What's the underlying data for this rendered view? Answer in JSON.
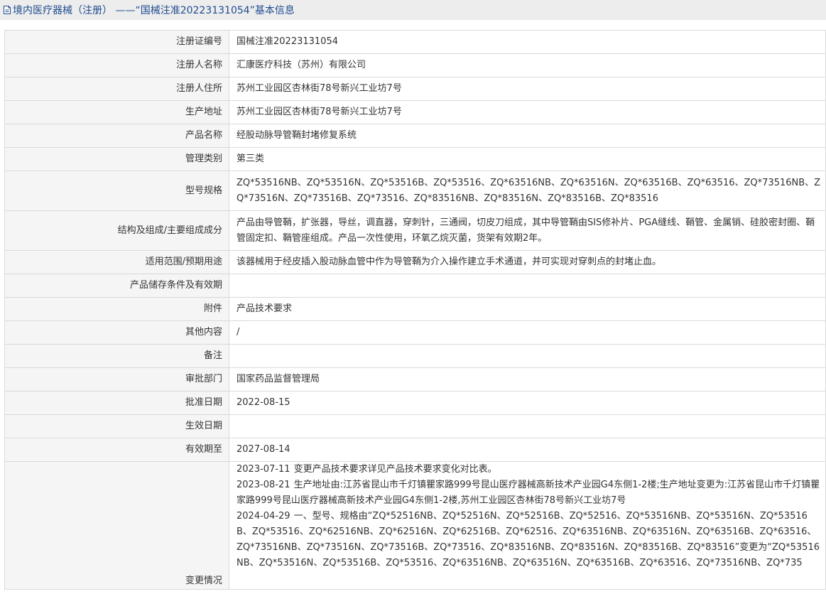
{
  "header": {
    "title": "境内医疗器械（注册） ——“国械注准20223131054”基本信息",
    "icon": "document-icon"
  },
  "rows": [
    {
      "label": "注册证编号",
      "value": "国械注准20223131054"
    },
    {
      "label": "注册人名称",
      "value": "汇康医疗科技（苏州）有限公司"
    },
    {
      "label": "注册人住所",
      "value": "苏州工业园区杏林街78号新兴工业坊7号"
    },
    {
      "label": "生产地址",
      "value": "苏州工业园区杏林街78号新兴工业坊7号"
    },
    {
      "label": "产品名称",
      "value": "经股动脉导管鞘封堵修复系统"
    },
    {
      "label": "管理类别",
      "value": "第三类"
    },
    {
      "label": "型号规格",
      "value": "ZQ*53516NB、ZQ*53516N、ZQ*53516B、ZQ*53516、ZQ*63516NB、ZQ*63516N、ZQ*63516B、ZQ*63516、ZQ*73516NB、ZQ*73516N、ZQ*73516B、ZQ*73516、ZQ*83516NB、ZQ*83516N、ZQ*83516B、ZQ*83516"
    },
    {
      "label": "结构及组成/主要组成成分",
      "value": "产品由导管鞘，扩张器，导丝，调直器，穿刺针，三通阀，切皮刀组成，其中导管鞘由SIS修补片、PGA缝线、鞘管、金属销、硅胶密封圈、鞘管固定扣、鞘管座组成。产品一次性使用，环氧乙烷灭菌，货架有效期2年。"
    },
    {
      "label": "适用范围/预期用途",
      "value": "该器械用于经皮插入股动脉血管中作为导管鞘为介入操作建立手术通道，并可实现对穿刺点的封堵止血。"
    },
    {
      "label": "产品储存条件及有效期",
      "value": ""
    },
    {
      "label": "附件",
      "value": "产品技术要求"
    },
    {
      "label": "其他内容",
      "value": "/"
    },
    {
      "label": "备注",
      "value": ""
    },
    {
      "label": "审批部门",
      "value": "国家药品监督管理局"
    },
    {
      "label": "批准日期",
      "value": "2022-08-15"
    },
    {
      "label": "生效日期",
      "value": ""
    },
    {
      "label": "有效期至",
      "value": "2027-08-14"
    }
  ],
  "changes": {
    "label": "变更情况",
    "entries": [
      {
        "date": "2023-07-11",
        "text": "变更产品技术要求详见产品技术要求变化对比表。"
      },
      {
        "date": "2023-08-21",
        "text": "生产地址由:江苏省昆山市千灯镇瞿家路999号昆山医疗器械高新技术产业园G4东侧1-2楼;生产地址变更为:江苏省昆山市千灯镇瞿家路999号昆山医疗器械高新技术产业园G4东侧1-2楼,苏州工业园区杏林街78号新兴工业坊7号"
      },
      {
        "date": "2024-04-29",
        "text": "一、型号、规格由“ZQ*52516NB、ZQ*52516N、ZQ*52516B、ZQ*52516、ZQ*53516NB、ZQ*53516N、ZQ*53516B、ZQ*53516、ZQ*62516NB、ZQ*62516N、ZQ*62516B、ZQ*62516、ZQ*63516NB、ZQ*63516N、ZQ*63516B、ZQ*63516、ZQ*73516NB、ZQ*73516N、ZQ*73516B、ZQ*73516、ZQ*83516NB、ZQ*83516N、ZQ*83516B、ZQ*83516”变更为“ZQ*53516NB、ZQ*53516N、ZQ*53516B、ZQ*53516、ZQ*63516NB、ZQ*63516N、ZQ*63516B、ZQ*63516、ZQ*73516NB、ZQ*735"
      }
    ]
  }
}
